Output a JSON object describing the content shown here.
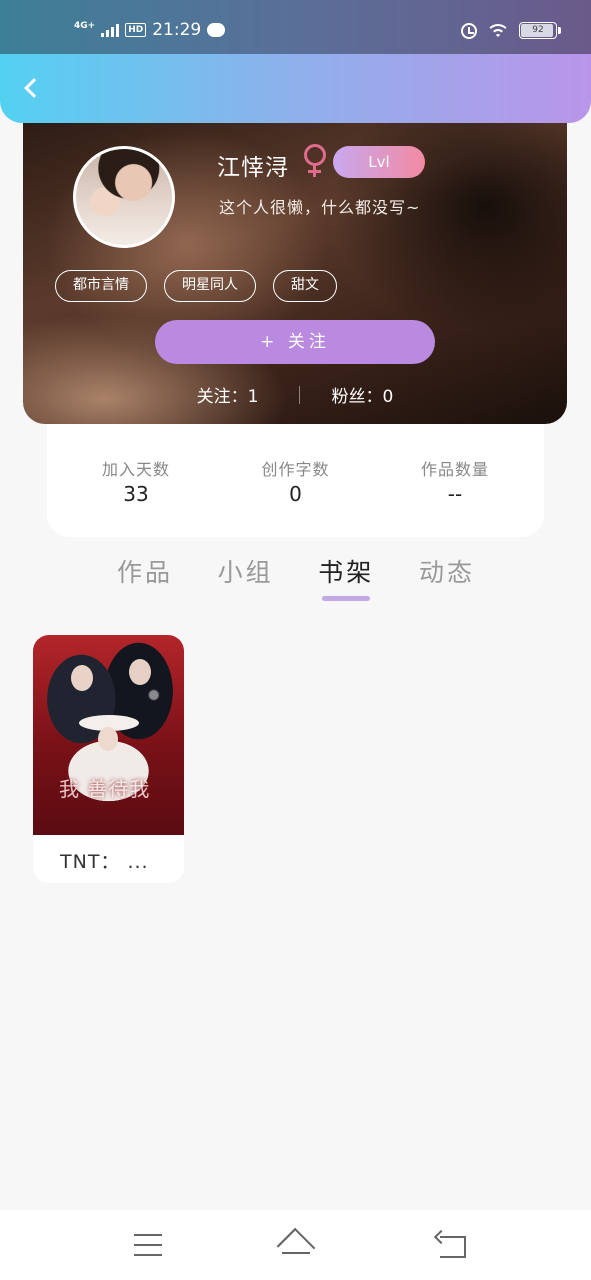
{
  "status_bar": {
    "network": "4G",
    "network_plus": "+",
    "hd_label": "HD",
    "time": "21:29",
    "battery": "92"
  },
  "header": {
    "back_icon": "chevron-left-icon"
  },
  "profile": {
    "username": "江悻浔",
    "gender_icon": "female-symbol-icon",
    "gender_color": "#e06b8d",
    "level": "Lvl",
    "bio": "这个人很懒，什么都没写~",
    "tags": [
      "都市言情",
      "明星同人",
      "甜文"
    ],
    "follow_button": "+ 关注",
    "following_label": "关注：",
    "following_count": "1",
    "fans_label": "粉丝：",
    "fans_count": "0"
  },
  "stats": [
    {
      "label": "加入天数",
      "value": "33"
    },
    {
      "label": "创作字数",
      "value": "0"
    },
    {
      "label": "作品数量",
      "value": "--"
    }
  ],
  "tabs": [
    {
      "label": "作品",
      "active": false
    },
    {
      "label": "小组",
      "active": false
    },
    {
      "label": "书架",
      "active": true
    },
    {
      "label": "动态",
      "active": false
    }
  ],
  "accent_color": "#c3a8e6",
  "bookshelf": [
    {
      "title": "TNT： ...",
      "cover_text": "我 善待我"
    }
  ],
  "bottom_nav": {
    "menu_icon": "menu-icon",
    "home_icon": "home-icon",
    "back_icon": "back-icon"
  }
}
